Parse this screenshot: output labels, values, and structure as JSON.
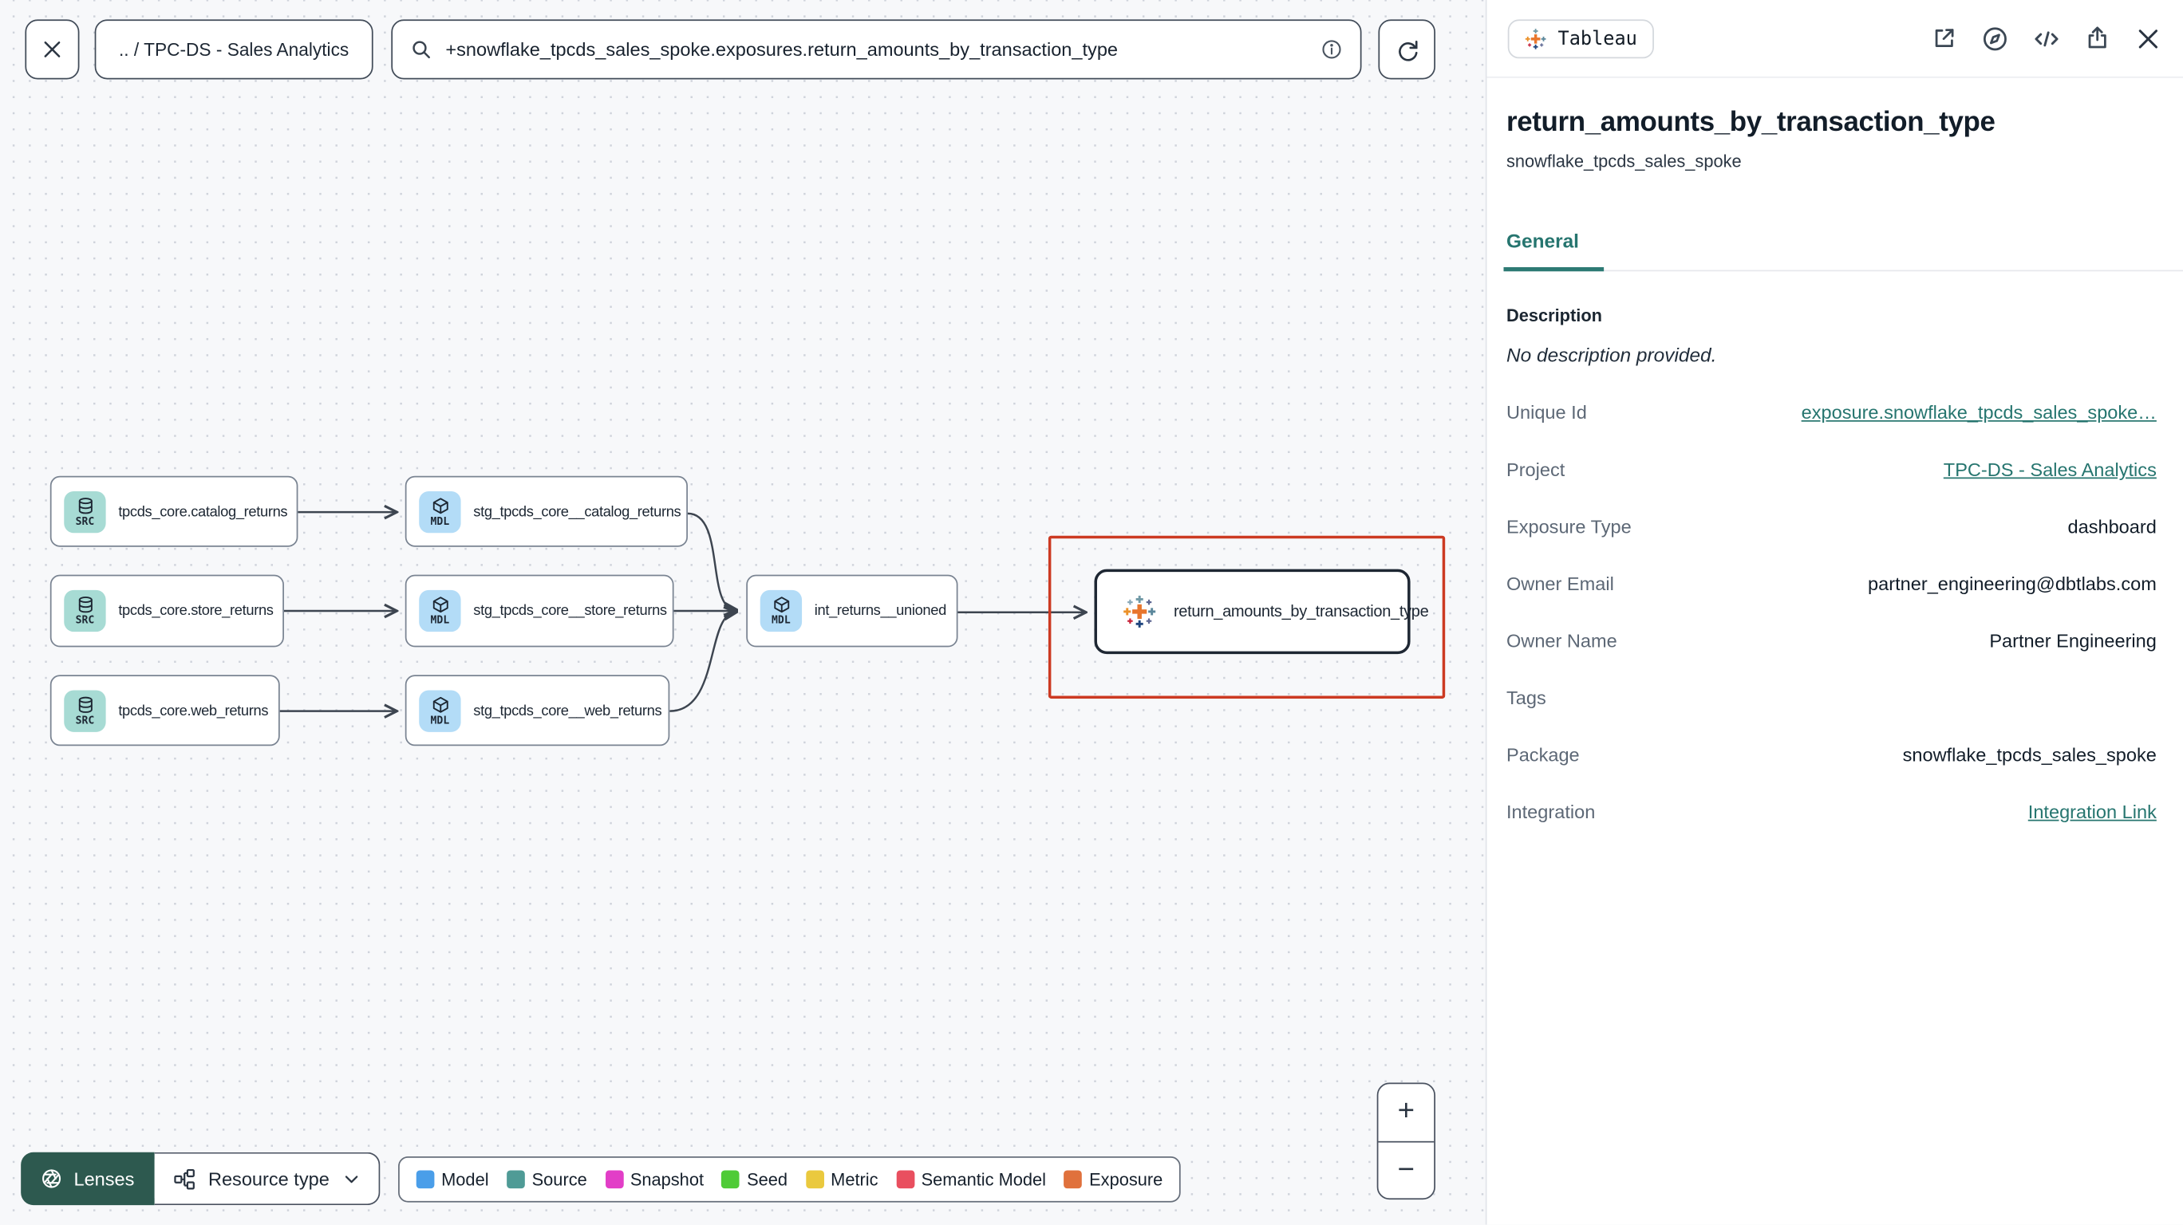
{
  "toolbar": {
    "breadcrumb": ".. / TPC-DS - Sales Analytics",
    "search_value": "+snowflake_tpcds_sales_spoke.exposures.return_amounts_by_transaction_type",
    "icons": [
      "close-icon",
      "search-icon",
      "info-icon",
      "refresh-icon"
    ]
  },
  "graph": {
    "nodes": [
      {
        "label": "tpcds_core.catalog_returns",
        "badge": "SRC",
        "type": "source"
      },
      {
        "label": "tpcds_core.store_returns",
        "badge": "SRC",
        "type": "source"
      },
      {
        "label": "tpcds_core.web_returns",
        "badge": "SRC",
        "type": "source"
      },
      {
        "label": "stg_tpcds_core__catalog_returns",
        "badge": "MDL",
        "type": "model"
      },
      {
        "label": "stg_tpcds_core__store_returns",
        "badge": "MDL",
        "type": "model"
      },
      {
        "label": "stg_tpcds_core__web_returns",
        "badge": "MDL",
        "type": "model"
      },
      {
        "label": "int_returns__unioned",
        "badge": "MDL",
        "type": "model"
      },
      {
        "label": "return_amounts_by_transaction_type",
        "type": "exposure",
        "icon": "tableau-logo"
      }
    ],
    "selection_color": "#cc3a22"
  },
  "legend": {
    "items": [
      {
        "label": "Model",
        "color": "#4a9ee9"
      },
      {
        "label": "Source",
        "color": "#4f9b96"
      },
      {
        "label": "Snapshot",
        "color": "#e23ec7"
      },
      {
        "label": "Seed",
        "color": "#4fcb37"
      },
      {
        "label": "Metric",
        "color": "#eac93e"
      },
      {
        "label": "Semantic Model",
        "color": "#e94f5f"
      },
      {
        "label": "Exposure",
        "color": "#e0713c"
      }
    ]
  },
  "controls": {
    "lenses_label": "Lenses",
    "resource_type_label": "Resource type",
    "zoom_in": "+",
    "zoom_out": "−"
  },
  "panel": {
    "integration_badge": "Tableau",
    "title": "return_amounts_by_transaction_type",
    "subtitle": "snowflake_tpcds_sales_spoke",
    "tab": "General",
    "description_label": "Description",
    "description_empty": "No description provided.",
    "action_icons": [
      "open-external-icon",
      "explore-icon",
      "code-icon",
      "share-icon",
      "close-icon"
    ],
    "fields": [
      {
        "label": "Unique Id",
        "value": "exposure.snowflake_tpcds_sales_spoke…",
        "link": true
      },
      {
        "label": "Project",
        "value": "TPC-DS - Sales Analytics",
        "link": true
      },
      {
        "label": "Exposure Type",
        "value": "dashboard",
        "link": false
      },
      {
        "label": "Owner Email",
        "value": "partner_engineering@dbtlabs.com",
        "link": false
      },
      {
        "label": "Owner Name",
        "value": "Partner Engineering",
        "link": false
      },
      {
        "label": "Tags",
        "value": "",
        "link": false
      },
      {
        "label": "Package",
        "value": "snowflake_tpcds_sales_spoke",
        "link": false
      },
      {
        "label": "Integration",
        "value": "Integration Link",
        "link": true
      }
    ]
  }
}
